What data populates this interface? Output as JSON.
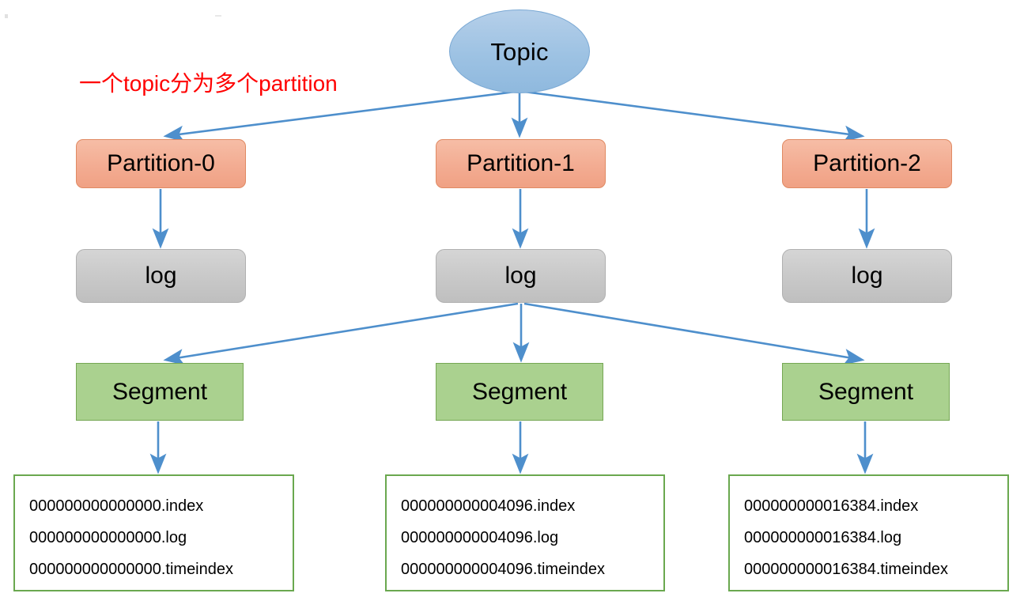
{
  "diagram": {
    "title_node": {
      "label": "Topic",
      "shape": "ellipse",
      "color": "#9dc2e3"
    },
    "annotation": {
      "text": "一个topic分为多个partition",
      "color": "#ff0000"
    },
    "colors": {
      "partition_fill": "#f3ac92",
      "partition_border": "#e08a63",
      "log_fill": "#c8c8c8",
      "log_border": "#b0b0b0",
      "segment_fill": "#aad18f",
      "segment_border": "#76a754",
      "files_border": "#6aa84f",
      "arrow": "#4e8fcc",
      "topic_fill": "#9dc2e3"
    },
    "partitions": [
      {
        "label": "Partition-0"
      },
      {
        "label": "Partition-1"
      },
      {
        "label": "Partition-2"
      }
    ],
    "logs": [
      {
        "label": "log"
      },
      {
        "label": "log"
      },
      {
        "label": "log"
      }
    ],
    "segments": [
      {
        "label": "Segment"
      },
      {
        "label": "Segment"
      },
      {
        "label": "Segment"
      }
    ],
    "file_groups": [
      {
        "base": "000000000000000",
        "files": [
          "000000000000000.index",
          "000000000000000.log",
          "000000000000000.timeindex"
        ]
      },
      {
        "base": "000000000004096",
        "files": [
          "000000000004096.index",
          "000000000004096.log",
          "000000000004096.timeindex"
        ]
      },
      {
        "base": "000000000016384",
        "files": [
          "000000000016384.index",
          "000000000016384.log",
          "000000000016384.timeindex"
        ]
      }
    ]
  }
}
